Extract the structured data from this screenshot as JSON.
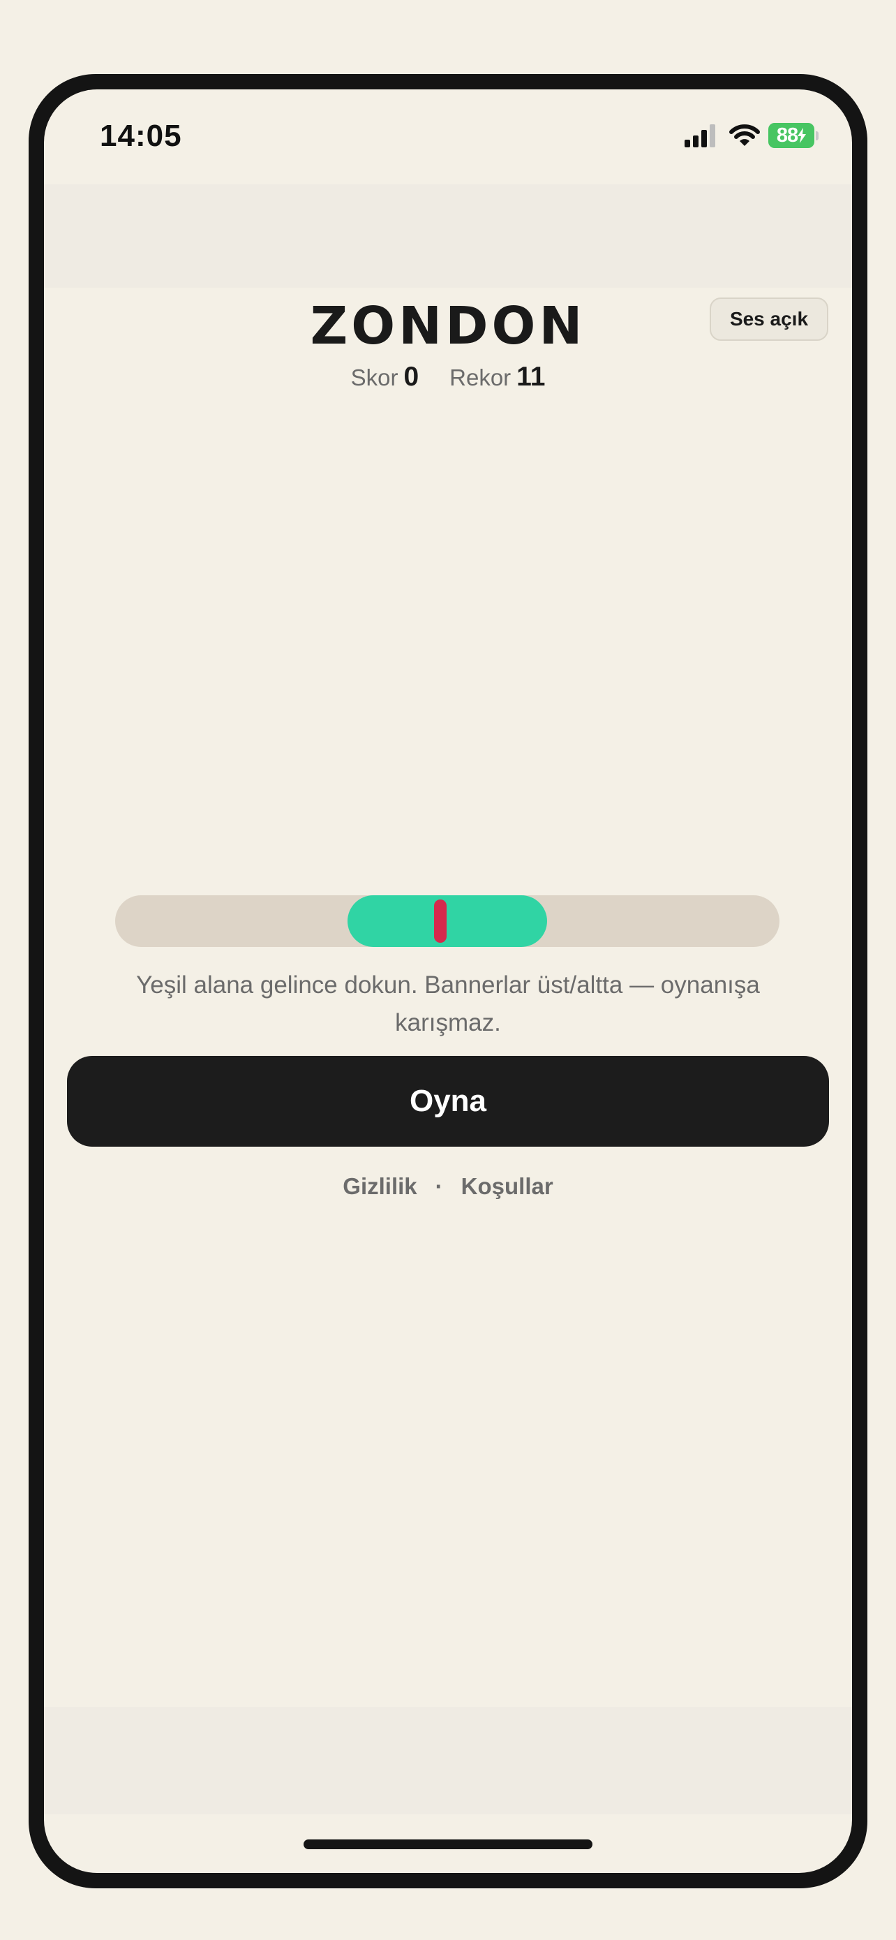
{
  "status_bar": {
    "time": "14:05",
    "battery": "88",
    "icons": [
      "cellular-signal-icon",
      "wifi-icon",
      "battery-charging-icon"
    ]
  },
  "header": {
    "title": "ZONDON",
    "sound_toggle": "Ses açık"
  },
  "scoreboard": {
    "score_label": "Skor",
    "score_value": "0",
    "record_label": "Rekor",
    "record_value": "11"
  },
  "game": {
    "green_zone_start": 0.35,
    "green_zone_end": 0.65,
    "marker_position": 0.49,
    "hint": "Yeşil alana gelince dokun. Bannerlar üst/altta — oynanışa karışmaz."
  },
  "actions": {
    "play_label": "Oyna"
  },
  "footer": {
    "privacy": "Gizlilik",
    "separator": "·",
    "terms": "Koşullar"
  },
  "colors": {
    "background": "#f4f0e6",
    "track": "#ddd4c7",
    "green_zone": "#30d4a4",
    "marker": "#d52a4c",
    "button": "#1c1c1c",
    "battery": "#47c562"
  }
}
